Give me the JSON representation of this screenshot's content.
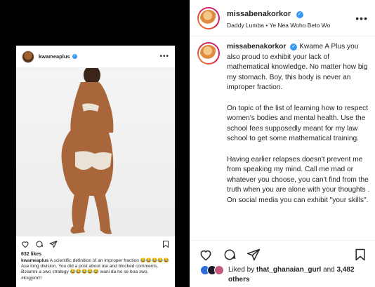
{
  "embedded_post": {
    "username": "kwameaplus",
    "likes": "632 likes",
    "caption_user": "kwameaplus",
    "caption_text": "A scientific definition of an improper fraction 😂😂😂😂😂 Ase long division. You did a post about me and blocked comments. Bɔlamni a ɔwo strategy 😂😂😂😂😂 wani da ho se boa ɔwo. #kɔgyim!!!"
  },
  "post": {
    "username": "missabenakorkor",
    "audio": "Daddy Lumba • Ye Nea Woho Beto Wo",
    "caption_user": "missabenakorkor",
    "caption_paragraphs": [
      "Kwame A Plus you also proud to exhibit your lack of mathematical knowledge. No matter how big my stomach. Boy, this body is never an improper fraction.",
      "On topic of the list of learning how to respect women's bodies and mental health. Use the school fees supposedly meant for my law school to get some mathematical training.",
      "Having earlier relapses doesn't prevent me from speaking my mind. Call me mad or whatever you choose, you can't find from the truth when you are alone with your thoughts . On social media you can exhibit \"your skills\"."
    ],
    "liked_prefix": "Liked by",
    "liked_user": "that_ghanaian_gurl",
    "liked_and": "and",
    "liked_count": "3,482 others"
  },
  "colors": {
    "verified_blue": "#3897f0",
    "text": "#262626",
    "divider": "#efefef",
    "media_bg": "#000000"
  },
  "icons": [
    "more-icon",
    "heart-icon",
    "comment-icon",
    "share-icon",
    "bookmark-icon",
    "verified-icon"
  ]
}
